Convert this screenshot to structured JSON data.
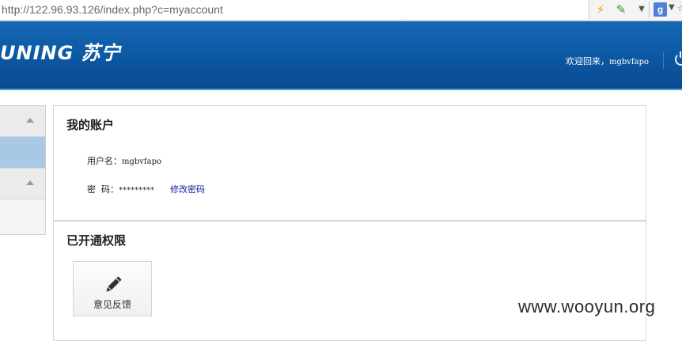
{
  "browser": {
    "url": "http://122.96.93.126/index.php?c=myaccount",
    "google_letter": "g"
  },
  "header": {
    "logo_text": "UNING 苏宁",
    "welcome_prefix": "欢迎回来，",
    "username": "mgbvfapo"
  },
  "account": {
    "title": "我的账户",
    "username_label": "用户名：",
    "username_value": "mgbvfapo",
    "password_label": "密  码：",
    "password_value": "*********",
    "change_password": "修改密码"
  },
  "permissions": {
    "title": "已开通权限",
    "items": [
      {
        "label": "意见反馈",
        "icon": "pencil-icon"
      }
    ]
  },
  "watermark": "www.wooyun.org"
}
